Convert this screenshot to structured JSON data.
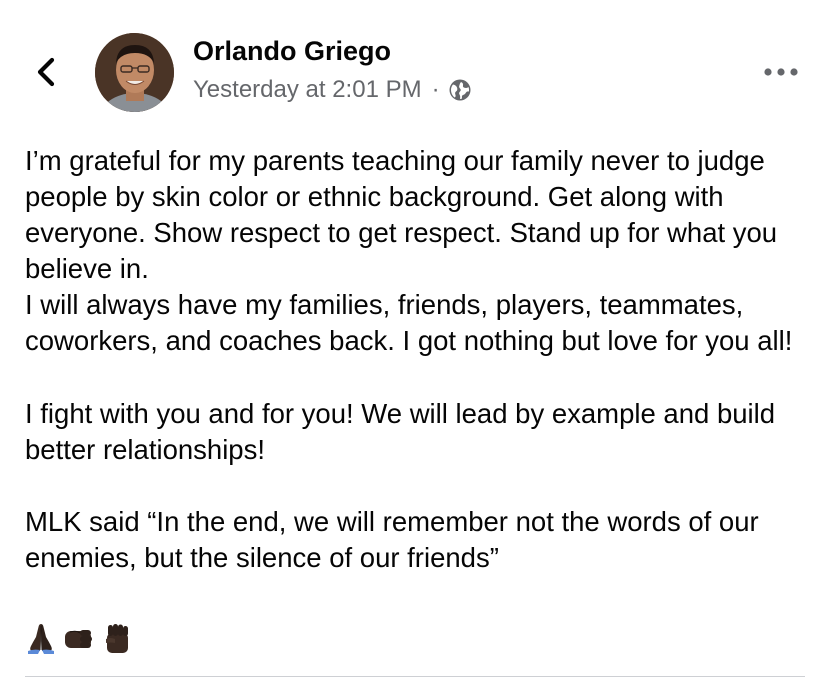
{
  "post": {
    "author": "Orlando Griego",
    "timestamp": "Yesterday at 2:01 PM",
    "separator": "·",
    "privacy_icon": "globe-icon",
    "paragraphs": [
      "I’m grateful for my parents teaching our family never to judge people by skin color or ethnic background. Get along with everyone. Show respect to get respect. Stand up for what you believe in.\nI will always have my families, friends, players, teammates, coworkers, and coaches back. I got nothing but love for you all!",
      "I fight with you and for you! We will lead by example and build better relationships!",
      "MLK said “In the end, we will remember not the words of our enemies, but the silence of our friends”"
    ],
    "emojis": [
      "folded-hands-emoji",
      "oncoming-fist-emoji",
      "raised-fist-emoji"
    ]
  },
  "icons": {
    "back": "chevron-left-icon",
    "more": "more-options-icon"
  },
  "colors": {
    "text_primary": "#050505",
    "text_secondary": "#65676b",
    "divider": "#ced0d4",
    "emoji_skin": "#3b2a22"
  }
}
